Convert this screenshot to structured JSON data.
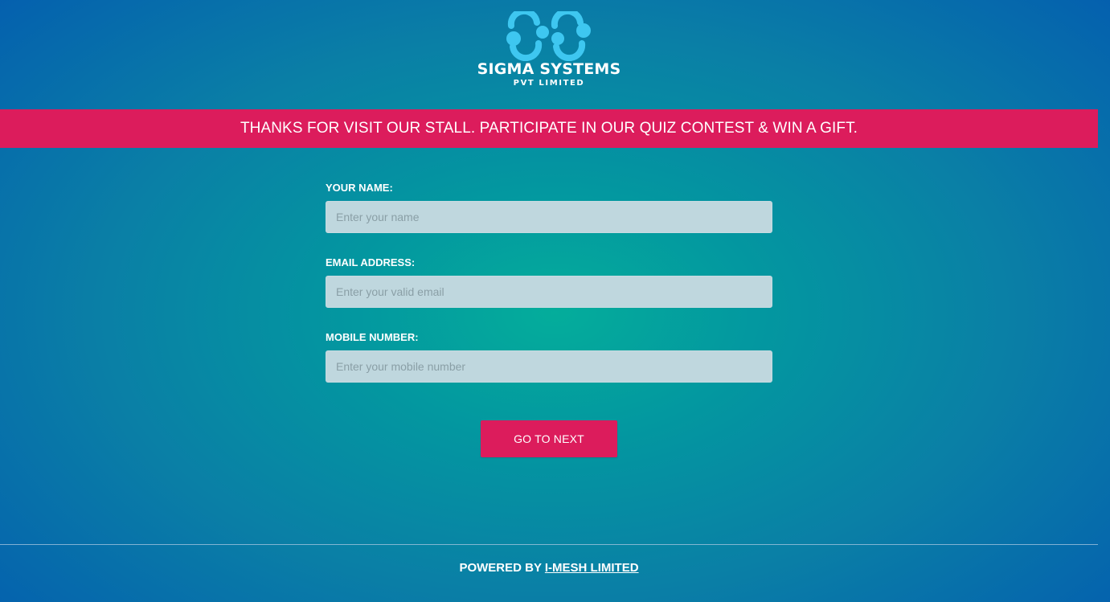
{
  "brand": {
    "logo_icon": "sigma-rings-logo-icon",
    "name": "SIGMA SYSTEMS",
    "tagline": "PVT LIMITED",
    "logo_color": "#3ec7f0"
  },
  "banner": {
    "text": "THANKS FOR VISIT OUR STALL. PARTICIPATE IN OUR QUIZ CONTEST & WIN A GIFT.",
    "color": "#dc1c5c"
  },
  "form": {
    "name": {
      "label": "YOUR NAME:",
      "placeholder": "Enter your name",
      "value": ""
    },
    "email": {
      "label": "EMAIL ADDRESS:",
      "placeholder": "Enter your valid email",
      "value": ""
    },
    "mobile": {
      "label": "MOBILE NUMBER:",
      "placeholder": "Enter your mobile number",
      "value": ""
    },
    "submit_label": "GO TO NEXT"
  },
  "footer": {
    "prefix": "POWERED BY",
    "link_text": "I-MESH LIMITED"
  }
}
